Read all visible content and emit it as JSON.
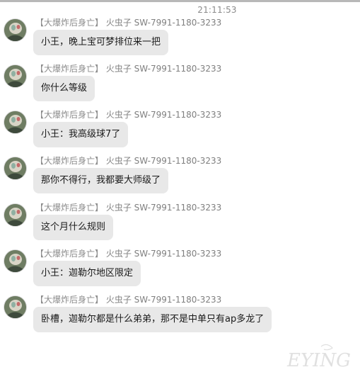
{
  "chat": {
    "timestamp": "21:11:53",
    "messages": [
      {
        "tag": "【大爆炸后身亡】",
        "name": "火虫子 SW-7991-1180-3233",
        "text": "小王，晚上宝可梦排位来一把"
      },
      {
        "tag": "【大爆炸后身亡】",
        "name": "火虫子 SW-7991-1180-3233",
        "text": "你什么等级"
      },
      {
        "tag": "【大爆炸后身亡】",
        "name": "火虫子 SW-7991-1180-3233",
        "text": "小王：我高级球7了"
      },
      {
        "tag": "【大爆炸后身亡】",
        "name": "火虫子 SW-7991-1180-3233",
        "text": "那你不得行，我都要大师级了"
      },
      {
        "tag": "【大爆炸后身亡】",
        "name": "火虫子 SW-7991-1180-3233",
        "text": "这个月什么规则"
      },
      {
        "tag": "【大爆炸后身亡】",
        "name": "火虫子 SW-7991-1180-3233",
        "text": "小王：迦勒尔地区限定"
      },
      {
        "tag": "【大爆炸后身亡】",
        "name": "火虫子 SW-7991-1180-3233",
        "text": "卧槽，迦勒尔都是什么弟弟，那不是中单只有ap多龙了"
      }
    ]
  },
  "watermark": {
    "text": "EYING",
    "color": "#c8c8c8"
  },
  "colors": {
    "bubble": "#e8e8e8",
    "sender_text": "#7f7f7f",
    "timestamp": "#8a8a8a"
  },
  "icons": {
    "avatar": "pokemon-avatar-icon"
  }
}
